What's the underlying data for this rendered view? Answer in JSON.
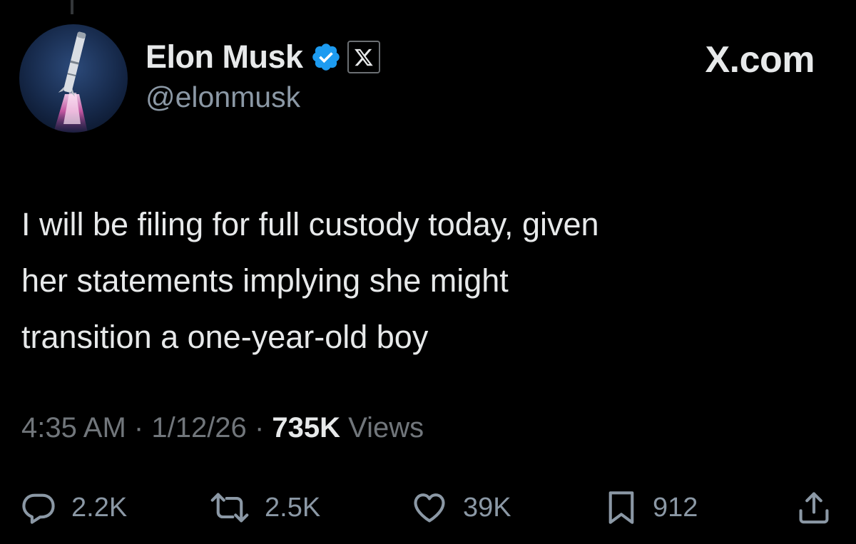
{
  "author": {
    "name": "Elon Musk",
    "handle": "@elonmusk",
    "avatar_icon": "rocket-launch-avatar",
    "verified_badge_color": "#1d9bf0",
    "affiliate_badge_icon": "x-logo-icon"
  },
  "header": {
    "site_label": "X.com"
  },
  "tweet": {
    "lines": [
      "I will be filing for full custody today, given",
      "her statements implying she might",
      "transition a one-year-old boy"
    ],
    "time": "4:35 AM",
    "date": "1/12/26",
    "views_count": "735K",
    "views_label": "Views",
    "separator": "·"
  },
  "actions": {
    "reply_count": "2.2K",
    "repost_count": "2.5K",
    "like_count": "39K",
    "bookmark_count": "912",
    "icons": [
      "reply-icon",
      "repost-icon",
      "like-icon",
      "bookmark-icon",
      "share-icon"
    ]
  },
  "colors": {
    "background": "#000000",
    "primary_text": "#e7e9ea",
    "secondary_text": "#71767b",
    "accent_blue": "#1d9bf0"
  }
}
